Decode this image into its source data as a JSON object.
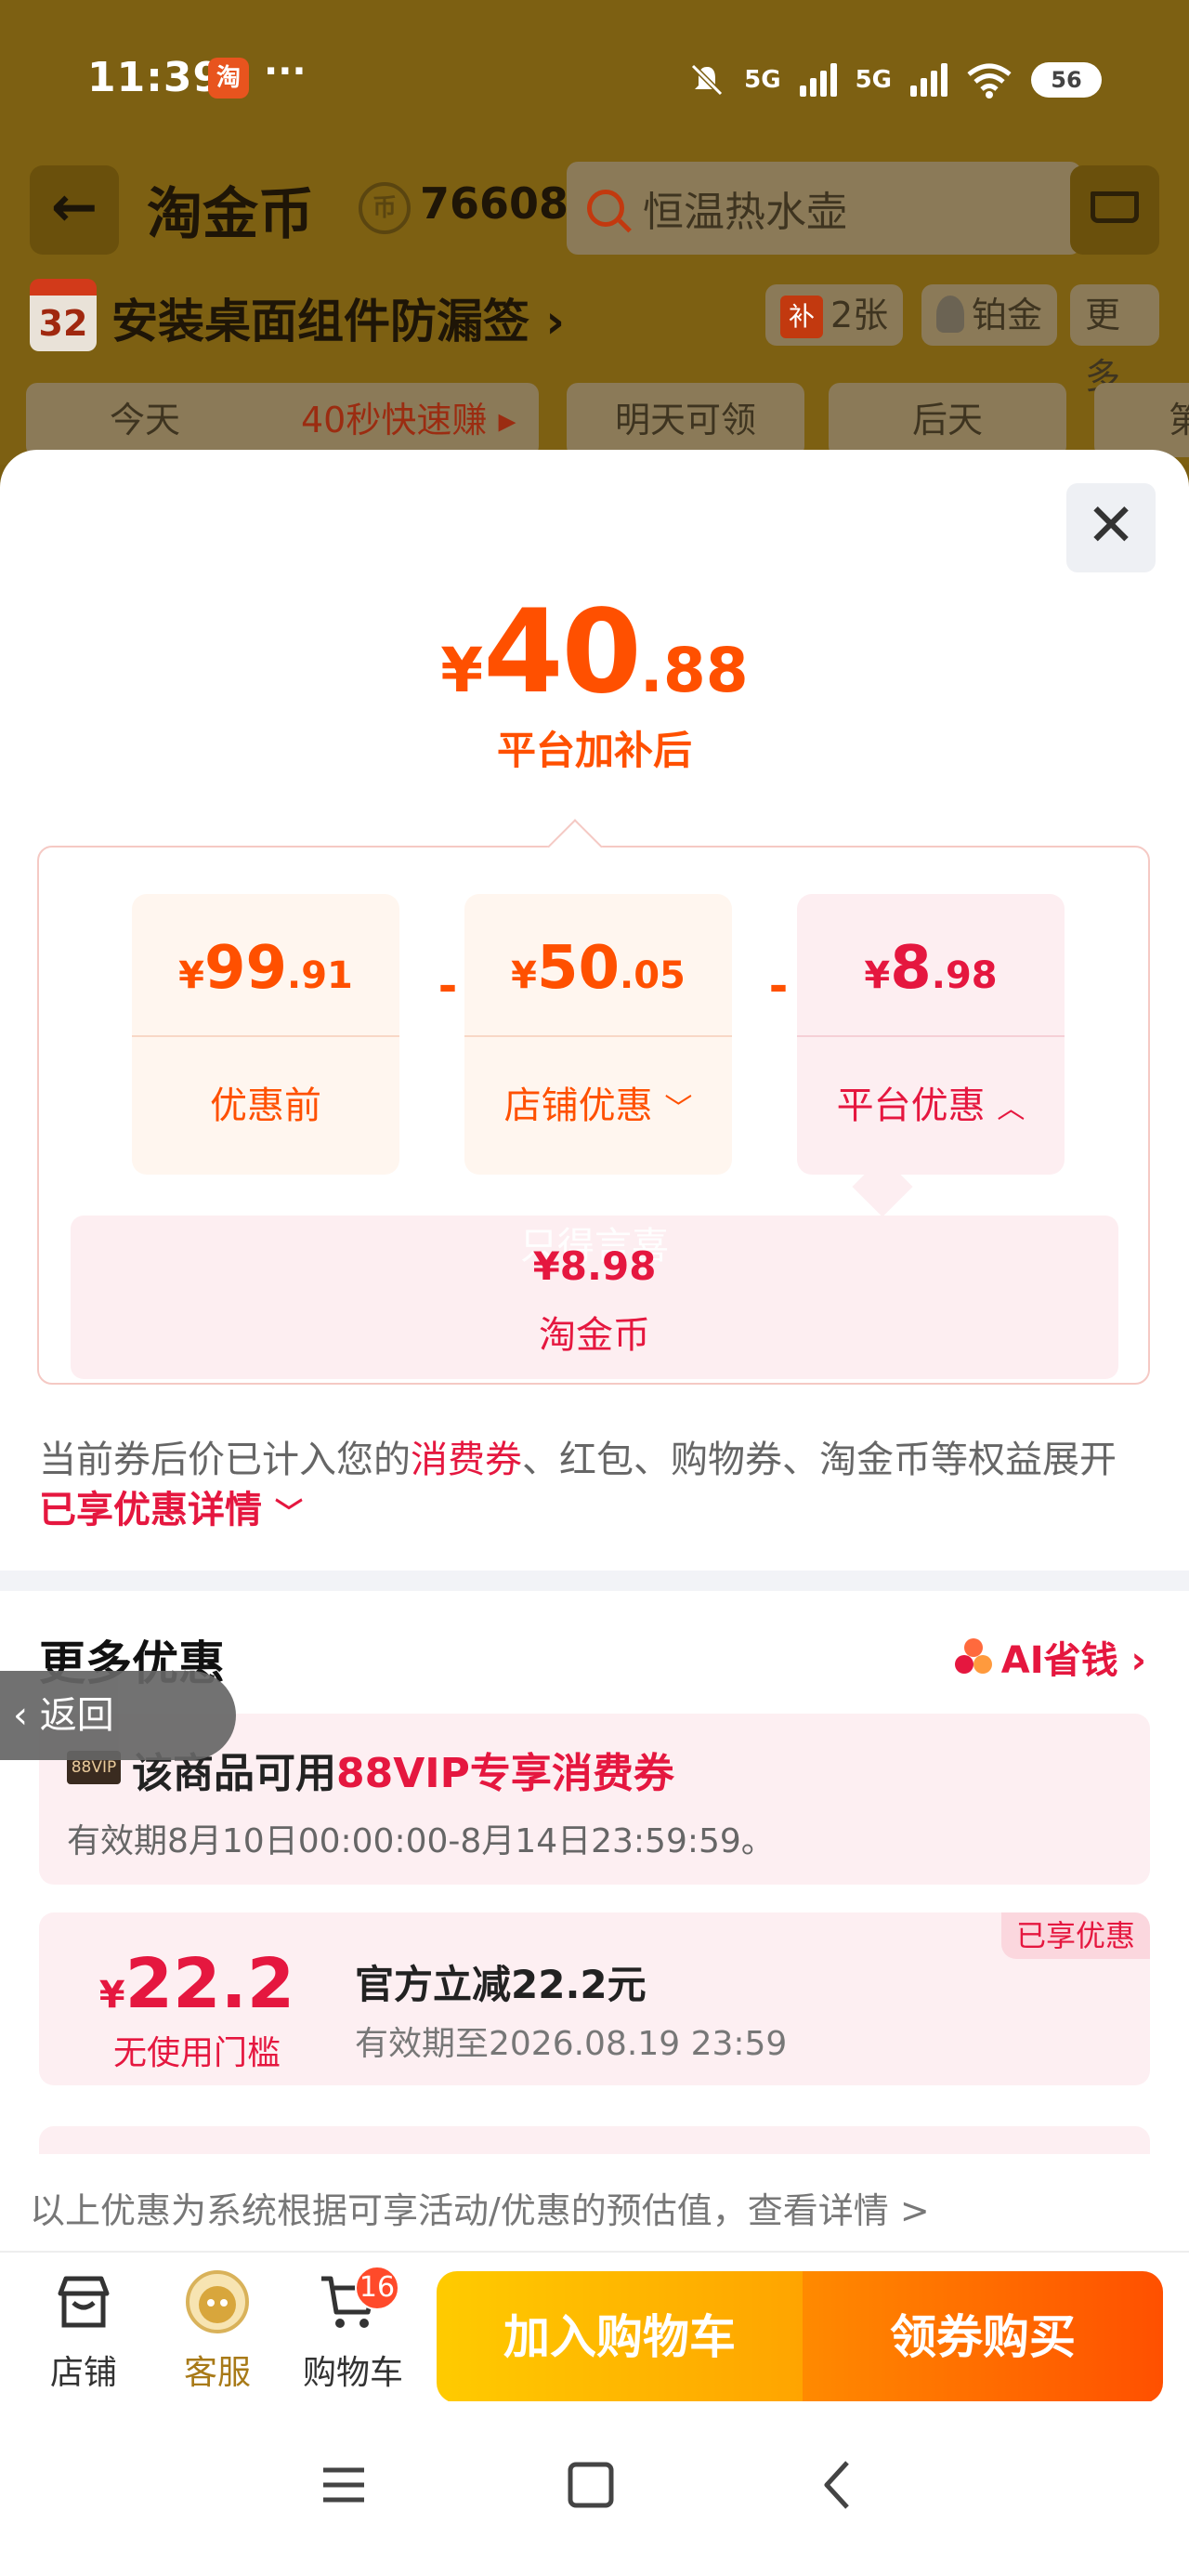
{
  "status_bar": {
    "time": "11:39",
    "app_badge": "淘",
    "more": "···",
    "signal1": "5G",
    "signal2": "5G",
    "battery": "56"
  },
  "header": {
    "title": "淘金币",
    "coin_count": "76608",
    "search_placeholder": "恒温热水壶"
  },
  "promo": {
    "calendar_day": "32",
    "text": "安装桌面组件防漏签",
    "chevron": "›",
    "chip_count": "2张",
    "chip_count_prefix": "补",
    "chip_level": "铂金",
    "chip_more": "更多"
  },
  "day_tabs": [
    {
      "label": "今天",
      "extra": "40秒快速赚"
    },
    {
      "label": "明天可领"
    },
    {
      "label": "后天"
    },
    {
      "label": "第"
    }
  ],
  "sheet": {
    "final_price": {
      "currency": "¥",
      "integer": "40",
      "decimal": ".88"
    },
    "final_label": "平台加补后",
    "cards": [
      {
        "currency": "¥",
        "integer": "99",
        "decimal": ".91",
        "label": "优惠前"
      },
      {
        "currency": "¥",
        "integer": "50",
        "decimal": ".05",
        "label": "店铺优惠",
        "chevron": "down"
      },
      {
        "currency": "¥",
        "integer": "8",
        "decimal": ".98",
        "label": "平台优惠",
        "chevron": "up"
      }
    ],
    "operators": [
      "-",
      "-"
    ],
    "platform_detail": {
      "watermark": "只得言喜",
      "value": "¥8.98",
      "name": "淘金币"
    },
    "notice": {
      "part1": "当前券后价已计入您的",
      "highlight1": "消费券",
      "part2": "、红包、购物券、淘金币等权益展开",
      "link": "已享优惠详情"
    },
    "more_title": "更多优惠",
    "ai_link": "AI省钱 ›",
    "back_float": "返回",
    "vip": {
      "badge": "88VIP",
      "title_prefix": "该商品可用",
      "title_highlight": "88VIP专享消费券",
      "validity": "有效期8月10日00:00:00-8月14日23:59:59。"
    },
    "coupon": {
      "tag": "已享优惠",
      "currency": "¥",
      "value": "22.2",
      "threshold": "无使用门槛",
      "name": "官方立减22.2元",
      "validity": "有效期至2026.08.19 23:59"
    },
    "footnote": "以上优惠为系统根据可享活动/优惠的预估值，查看详情 >"
  },
  "action_bar": {
    "store": "店铺",
    "service": "客服",
    "cart": "购物车",
    "cart_badge": "16",
    "add_to_cart": "加入购物车",
    "buy": "领券购买"
  },
  "colors": {
    "accent_orange": "#ff5000",
    "accent_red": "#e5173f",
    "cart_yellow": "#ffcb00"
  }
}
